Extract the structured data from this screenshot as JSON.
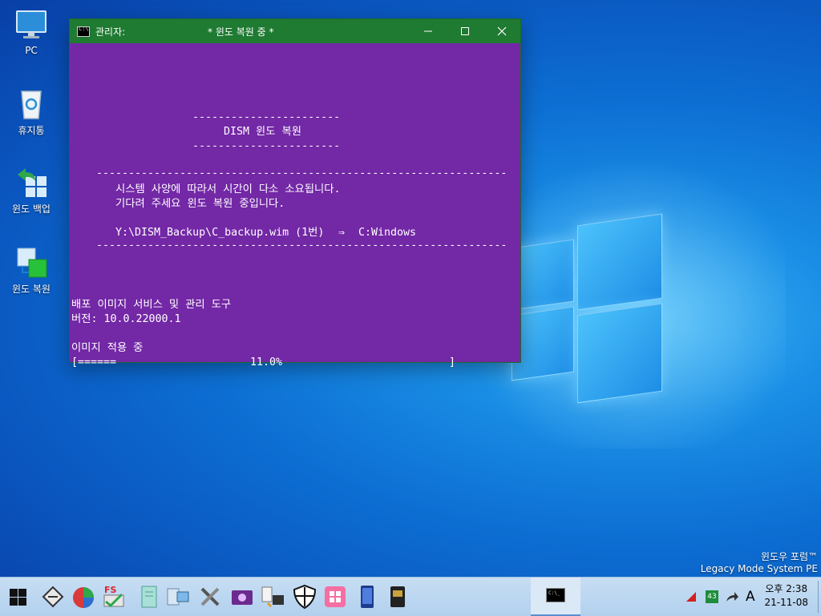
{
  "desktop": {
    "icons": [
      {
        "label": "PC",
        "icon": "monitor-icon"
      },
      {
        "label": "휴지통",
        "icon": "recycle-bin-icon"
      },
      {
        "label": "윈도 백업",
        "icon": "windows-backup-icon"
      },
      {
        "label": "윈도 복원",
        "icon": "windows-restore-icon"
      }
    ],
    "watermark": {
      "line1": "윈도우 포럼™",
      "line2": "Legacy Mode System PE"
    }
  },
  "window": {
    "title_left": "관리자:",
    "title": "* 윈도 복원 중 *",
    "controls": [
      "minimize",
      "maximize",
      "close"
    ],
    "console": {
      "rule_short": "-----------------------",
      "heading": "DISM 윈도 복원",
      "rule_long": "----------------------------------------------------------------",
      "msg1": "시스템 사양에 따라서 시간이 다소 소요됩니다.",
      "msg2": "기다려 주세요 윈도 복원 중입니다.",
      "source": "Y:\\DISM_Backup\\C_backup.wim (1번)",
      "arrow": "⇒",
      "target": "C:Windows",
      "tool_name": "배포 이미지 서비스 및 관리 도구",
      "version": "버전: 10.0.22000.1",
      "status": "이미지 적용 중",
      "progress_bar": "[======",
      "progress_percent": "11.0%",
      "progress_end": "]",
      "progress_value": 0.11
    }
  },
  "taskbar": {
    "start_icon": "windows-start-icon",
    "apps": [
      "disk-tool-icon",
      "partition-tool-icon",
      "fs-tool-icon",
      "document-icon",
      "network-icon",
      "tools-icon",
      "media-icon",
      "file-manager-icon",
      "shield-icon",
      "pink-app-icon",
      "phone-icon",
      "card-icon"
    ],
    "active_app": "console-icon",
    "tray": {
      "badge": "43",
      "ime": "A"
    },
    "clock": {
      "time": "오후 2:38",
      "date": "21-11-08"
    }
  },
  "colors": {
    "console_bg": "#7328a6",
    "titlebar": "#1f7a32",
    "taskbar": "#b9d5f0"
  }
}
